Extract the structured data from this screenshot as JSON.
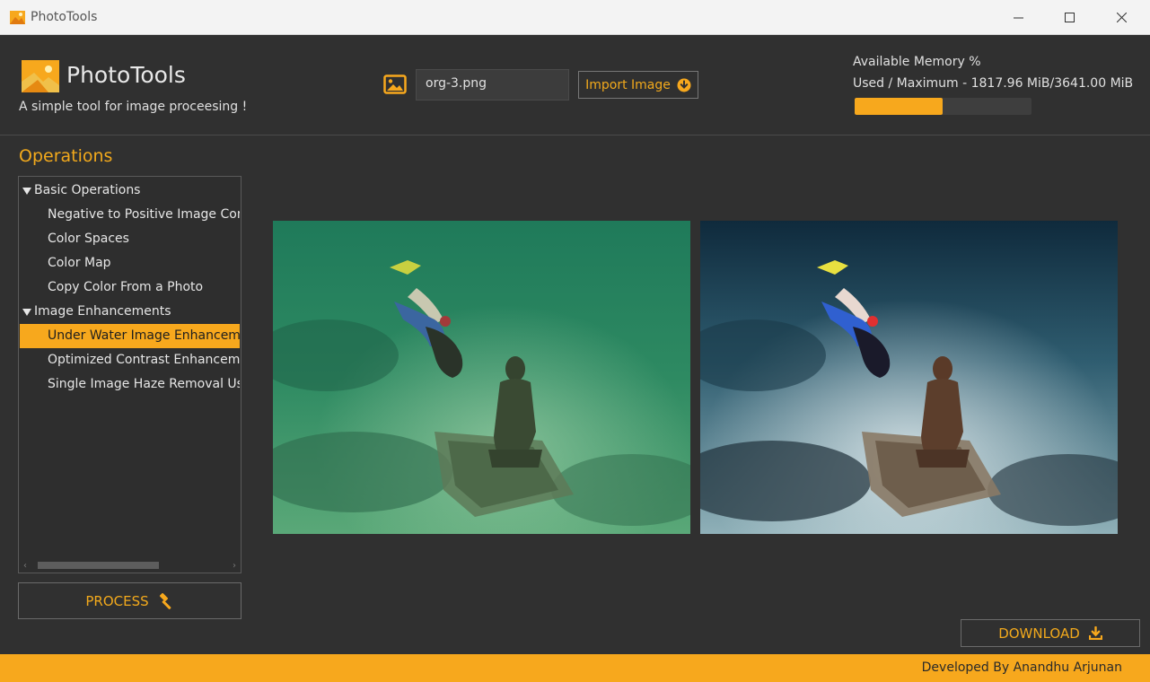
{
  "window": {
    "title": "PhotoTools"
  },
  "header": {
    "brand_name": "PhotoTools",
    "tagline": "A simple tool for image proceesing !",
    "file_name": "org-3.png",
    "import_label": "Import Image",
    "memory_title": "Available Memory %",
    "memory_used": "Used / Maximum - 1817.96 MiB/3641.00 MiB",
    "memory_fraction": 0.499
  },
  "sidebar": {
    "title": "Operations",
    "groups": [
      {
        "label": "Basic Operations",
        "items": [
          "Negative to Positive Image Con",
          "Color Spaces",
          "Color Map",
          "Copy Color From a Photo"
        ]
      },
      {
        "label": "Image Enhancements",
        "items": [
          "Under Water Image Enhanceme",
          "Optimized Contrast Enhanceme",
          "Single Image Haze Removal Us"
        ]
      }
    ],
    "selected": "Under Water Image Enhanceme"
  },
  "actions": {
    "process_label": "PROCESS",
    "download_label": "DOWNLOAD"
  },
  "footer": {
    "credit": "Developed By Anandhu Arjunan"
  },
  "colors": {
    "accent": "#f7a81d",
    "background": "#303030"
  }
}
